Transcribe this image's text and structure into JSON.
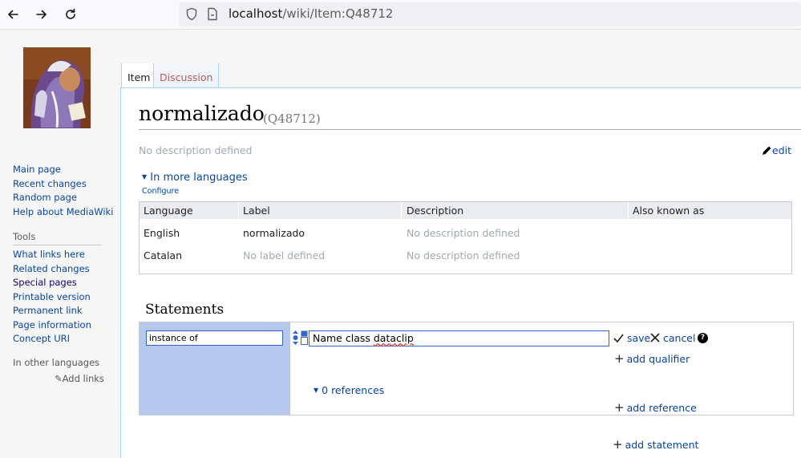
{
  "browser": {
    "url_host": "localhost",
    "url_path": "/wiki/Item:Q48712"
  },
  "sidebar": {
    "navigation": [
      {
        "label": "Main page"
      },
      {
        "label": "Recent changes"
      },
      {
        "label": "Random page"
      },
      {
        "label": "Help about MediaWiki"
      }
    ],
    "tools_heading": "Tools",
    "tools": [
      {
        "label": "What links here"
      },
      {
        "label": "Related changes"
      },
      {
        "label": "Special pages"
      },
      {
        "label": "Printable version"
      },
      {
        "label": "Permanent link"
      },
      {
        "label": "Page information"
      },
      {
        "label": "Concept URI"
      }
    ],
    "languages_heading": "In other languages",
    "add_links": "Add links"
  },
  "tabs": {
    "item": "Item",
    "discussion": "Discussion"
  },
  "page": {
    "title": "normalizado",
    "qid": "(Q48712)",
    "description": "No description defined",
    "edit": "edit",
    "more_languages": "In more languages",
    "configure": "Configure"
  },
  "lang_table": {
    "headers": [
      "Language",
      "Label",
      "Description",
      "Also known as"
    ],
    "rows": [
      {
        "language": "English",
        "label": "normalizado",
        "description": "No description defined"
      },
      {
        "language": "Catalan",
        "label": "No label defined",
        "description": "No description defined"
      }
    ]
  },
  "statements": {
    "heading": "Statements",
    "property_value": "instance of",
    "value_prefix": "Name class ",
    "value_misspelled": "dataclip",
    "save": "save",
    "cancel": "cancel",
    "add_qualifier": "add qualifier",
    "references": "0 references",
    "add_reference": "add reference",
    "add_statement": "add statement"
  }
}
